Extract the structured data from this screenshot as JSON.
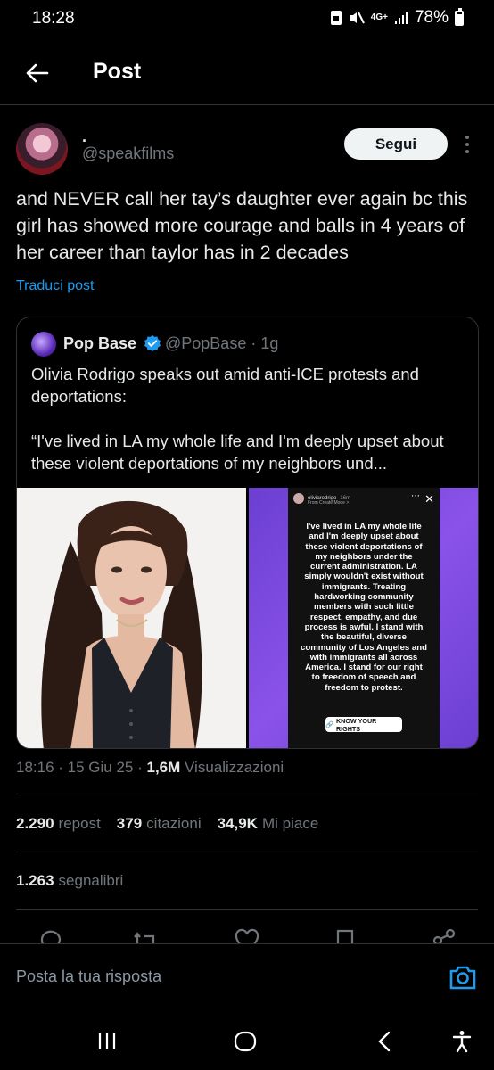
{
  "status_bar": {
    "time": "18:28",
    "network": "4G+",
    "battery": "78%"
  },
  "header": {
    "title": "Post"
  },
  "post": {
    "author_name": ".",
    "author_handle": "@speakfilms",
    "follow_label": "Segui",
    "text": "and NEVER call her tay’s daughter ever again bc this girl has showed more courage and balls in 4 years of her career than taylor has in 2 decades",
    "translate_label": "Traduci post"
  },
  "quote": {
    "name": "Pop Base",
    "handle": "@PopBase · 1g",
    "text": "Olivia Rodrigo speaks out amid anti-ICE protests and deportations:\n\n“I've lived in LA my whole life and I'm deeply upset about these violent deportations of my neighbors und...",
    "story": {
      "user": "oliviarodrigo",
      "time": "16m",
      "sub": "From Create Mode >",
      "text": "I've lived in LA my whole life and I'm deeply upset about these violent deportations of my neighbors under the current administration. LA simply wouldn't exist without immigrants. Treating hardworking community members with such little respect, empathy, and due process is awful. I stand with the beautiful, diverse community of Los Angeles and with immigrants all across America. I stand for our right to freedom of speech and freedom to protest.",
      "button": "KNOW YOUR RIGHTS"
    }
  },
  "meta": {
    "time_date": "18:16 · 15 Giu 25 · ",
    "views_count": "1,6M",
    "views_label": "Visualizzazioni"
  },
  "stats": {
    "reposts_count": "2.290",
    "reposts_label": "repost",
    "quotes_count": "379",
    "quotes_label": "citazioni",
    "likes_count": "34,9K",
    "likes_label": "Mi piace",
    "bookmarks_count": "1.263",
    "bookmarks_label": "segnalibri"
  },
  "reply": {
    "placeholder": "Posta la tua risposta"
  },
  "colors": {
    "background": "#000000",
    "text": "#e7e9ea",
    "secondary": "#71767b",
    "accent": "#1d9bf0",
    "divider": "#2f3336"
  },
  "icons": [
    "back-arrow-icon",
    "more-dots-icon",
    "verified-icon",
    "reply-icon",
    "repost-icon",
    "like-icon",
    "bookmark-icon",
    "share-icon",
    "camera-icon",
    "recents-icon",
    "home-icon",
    "back-nav-icon",
    "accessibility-icon"
  ]
}
